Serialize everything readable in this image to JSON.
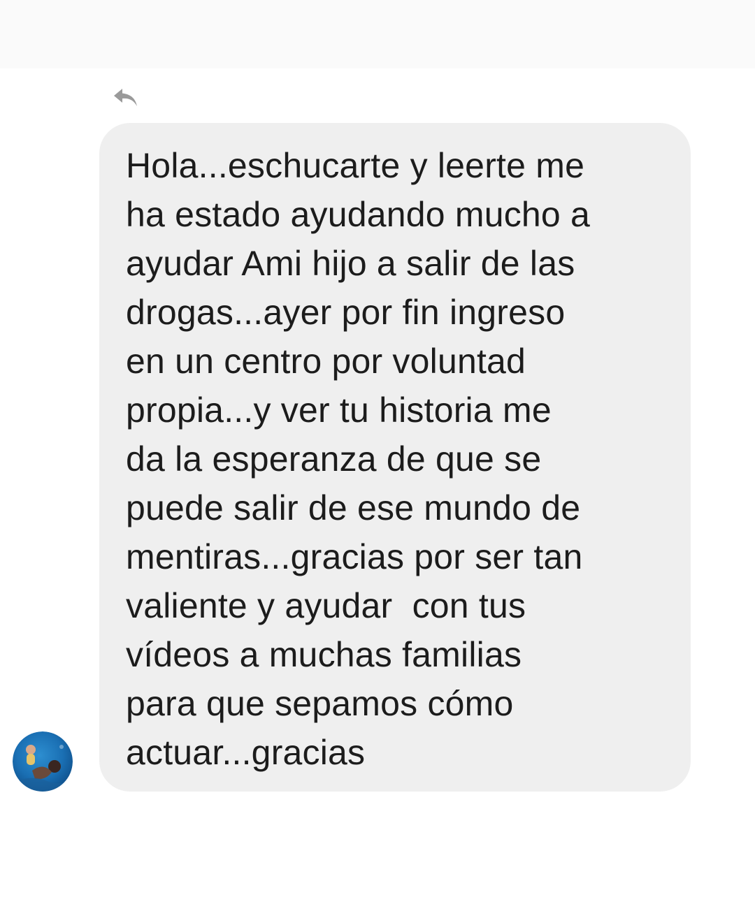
{
  "header": {
    "reply_icon": "reply-arrow-icon"
  },
  "message": {
    "lines": [
      "Hola...eschucarte y leerte me",
      "ha estado ayudando mucho a",
      "ayudar Ami hijo a salir de las",
      "drogas...ayer por fin ingreso",
      "en un centro por voluntad",
      "propia...y ver tu historia me",
      "da la esperanza de que se",
      "puede salir de ese mundo de",
      "mentiras...gracias por ser tan",
      "valiente y ayudar  con tus",
      "vídeos a muchas familias",
      "para que sepamos cómo",
      "actuar...gracias"
    ]
  },
  "sender": {
    "avatar_icon": "sender-avatar"
  },
  "colors": {
    "bubble_background": "#efefef",
    "text": "#1c1c1c",
    "icon": "#9a9a9a",
    "top_bar": "#fafafa"
  }
}
